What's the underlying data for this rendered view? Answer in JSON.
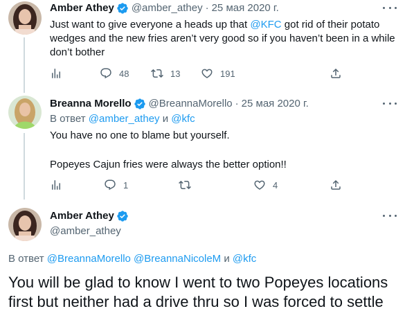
{
  "tweets": [
    {
      "name": "Amber Athey",
      "handle": "@amber_athey",
      "sep": "·",
      "date": "25 мая 2020 г.",
      "text_before": "Just want to give everyone a heads up that ",
      "mention": "@KFC",
      "text_after": " got rid of their potato wedges and the new fries aren’t very good so if you haven’t been in a while don’t bother",
      "actions": {
        "replies": "48",
        "retweets": "13",
        "likes": "191"
      }
    },
    {
      "name": "Breanna Morello",
      "handle": "@BreannaMorello",
      "sep": "·",
      "date": "25 мая 2020 г.",
      "reply_prefix": "В ответ ",
      "reply_user1": "@amber_athey",
      "reply_and": " и ",
      "reply_user2": "@kfc",
      "line1": "You have no one to blame but yourself.",
      "line2": "Popeyes Cajun fries were always the better option!!",
      "actions": {
        "replies": "1",
        "retweets": "",
        "likes": "4"
      }
    },
    {
      "name": "Amber Athey",
      "handle": "@amber_athey",
      "reply_prefix": "В ответ ",
      "reply_user1": "@BreannaMorello",
      "reply_space": " ",
      "reply_user2": "@BreannaNicoleM",
      "reply_and": " и ",
      "reply_user3": "@kfc",
      "text": "You will be glad to know I went to two Popeyes locations first but neither had a drive thru so I was forced to settle"
    }
  ],
  "colors": {
    "accent": "#1d9bf0",
    "muted": "#536471",
    "text": "#0f1419",
    "line": "#cfd9de"
  },
  "icons": [
    "verified-badge-icon",
    "more-icon",
    "analytics-icon",
    "reply-icon",
    "retweet-icon",
    "like-icon",
    "share-icon"
  ]
}
